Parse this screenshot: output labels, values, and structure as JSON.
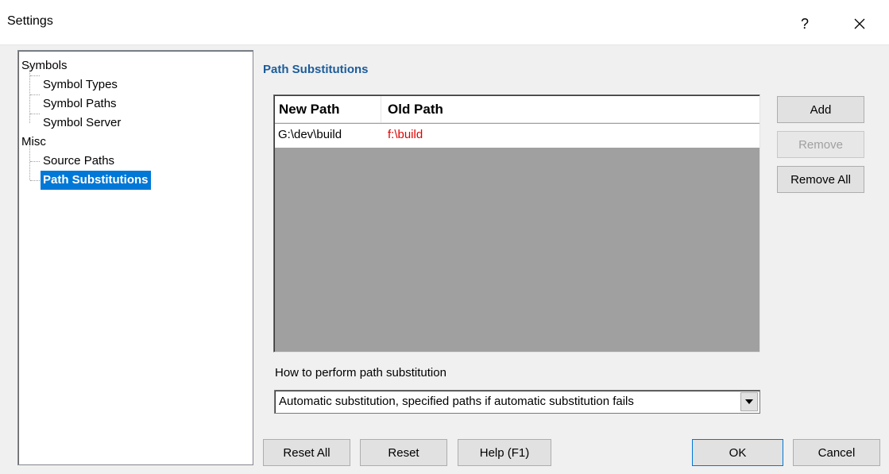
{
  "window": {
    "title": "Settings",
    "help_label": "?",
    "close_label": "✕"
  },
  "tree": {
    "items": [
      {
        "label": "Symbols",
        "level": 0
      },
      {
        "label": "Symbol Types",
        "level": 1
      },
      {
        "label": "Symbol Paths",
        "level": 1
      },
      {
        "label": "Symbol Server",
        "level": 1
      },
      {
        "label": "Misc",
        "level": 0
      },
      {
        "label": "Source Paths",
        "level": 1
      },
      {
        "label": "Path Substitutions",
        "level": 1,
        "selected": true
      }
    ]
  },
  "page": {
    "title": "Path Substitutions"
  },
  "table": {
    "columns": [
      "New Path",
      "Old Path"
    ],
    "rows": [
      {
        "new_path": "G:\\dev\\build",
        "old_path": "f:\\build"
      }
    ],
    "old_path_color": "#e00000"
  },
  "side_buttons": {
    "add": "Add",
    "remove": "Remove",
    "remove_all": "Remove All"
  },
  "substitution": {
    "label": "How to perform path substitution",
    "selected": "Automatic substitution, specified paths if automatic substitution fails"
  },
  "footer": {
    "reset_all": "Reset All",
    "reset": "Reset",
    "help": "Help (F1)",
    "ok": "OK",
    "cancel": "Cancel"
  },
  "colors": {
    "selection": "#0078d7",
    "section_title": "#1c5c9a"
  }
}
